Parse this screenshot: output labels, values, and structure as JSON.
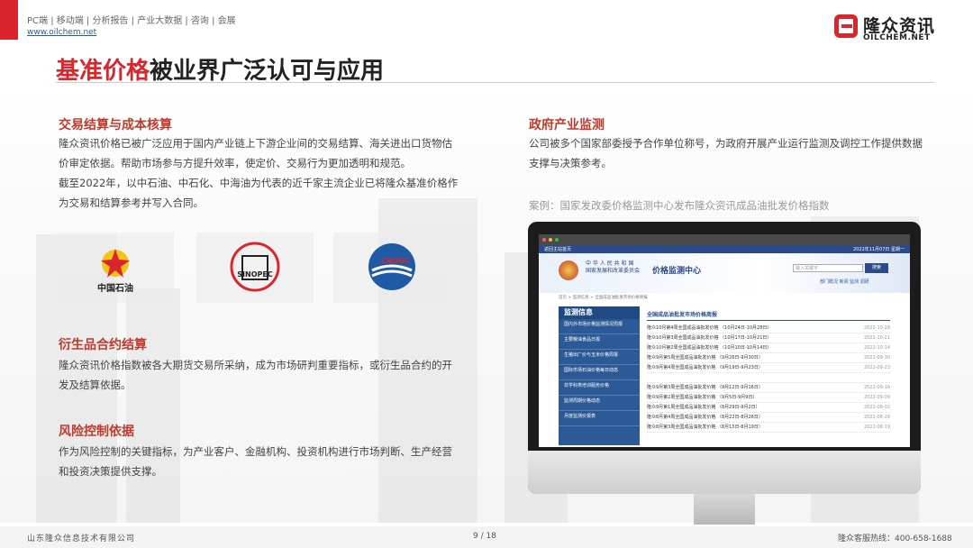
{
  "header": {
    "nav_text": "PC端 | 移动端 | 分析报告 | 产业大数据 | 咨询 | 会展",
    "site_link": "www.oilchem.net",
    "logo_cn": "隆众资讯",
    "logo_en": "OILCHEM.NET",
    "brand_color": "#d9252b"
  },
  "title": {
    "highlight": "基准价格",
    "rest": "被业界广泛认可与应用"
  },
  "left": {
    "sec1": {
      "heading": "交易结算与成本核算",
      "para1": "隆众资讯价格已被广泛应用于国内产业链上下游企业间的交易结算、海关进出口货物估价审定依据。帮助市场参与方提升效率，使定价、交易行为更加透明和规范。",
      "para2": "截至2022年，以中石油、中石化、中海油为代表的近千家主流企业已将隆众基准价格作为交易和结算参考并写入合同。"
    },
    "company_logos": [
      {
        "name": "中国石油"
      },
      {
        "name": "SINOPEC"
      },
      {
        "name": "CNOOC"
      }
    ],
    "sec2": {
      "heading": "衍生品合约结算",
      "para": "隆众资讯价格指数被各大期货交易所采纳，成为市场研判重要指标，或衍生品合约的开发及结算依据。"
    },
    "sec3": {
      "heading": "风险控制依据",
      "para": "作为风险控制的关键指标，为产业客户、金融机构、投资机构进行市场判断、生产经营和投资决策提供支撑。"
    }
  },
  "right": {
    "sec": {
      "heading": "政府产业监测",
      "para": "公司被多个国家部委授予合作单位称号，为政府开展产业运行监测及调控工作提供数据支撑与决策参考。"
    },
    "case_label": "案例：国家发改委价格监测中心发布隆众资讯成品油批发价格指数",
    "screen": {
      "subbar_left": "返回主站首页",
      "subbar_right": "2022年11月07日 星期一",
      "site_title_line1": "中 华 人 民 共 和 国",
      "site_title_line2": "国家发展和改革委员会",
      "site_title_main": "价格监测中心",
      "search_placeholder": "输入关键字",
      "search_button": "搜索",
      "links": "部门概况  新闻  监测  调研",
      "breadcrumb": "首页 > 监测信息 > 全国成品油批发市场价格周报",
      "menu_header": "监测信息",
      "menu_items": [
        "国内外市场价格监测情况周报",
        "主要粮油食品日报",
        "生猪出厂价与玉米价格周报",
        "国际市场石油价格每日动态",
        "非学科类培训服务价格",
        "监测周期价格动态",
        "月度监测价报表"
      ],
      "list_header": "全国成品油批发市场价格周报",
      "list_rows": [
        {
          "t": "隆众10月第4周全国成品油批发价格  （10月24日-10月28日）",
          "d": "2022-10-28"
        },
        {
          "t": "隆众10月第3周全国成品油批发价格  （10月17日-10月21日）",
          "d": "2022-10-21"
        },
        {
          "t": "隆众10月第2周全国成品油批发价格  （10月10日-10月14日）",
          "d": "2022-10-14"
        },
        {
          "t": "隆众9月第5周全国成品油批发价格  （9月26日-9月30日）",
          "d": "2022-09-30"
        },
        {
          "t": "隆众9月第4周全国成品油批发价格  （9月19日-9月23日）",
          "d": "2022-09-23"
        },
        {
          "t": "",
          "d": ""
        },
        {
          "t": "隆众9月第3周全国成品油批发价格  （9月12日-9月16日）",
          "d": "2022-09-16"
        },
        {
          "t": "隆众9月第2周全国成品油批发价格  （9月5日-9月9日）",
          "d": "2022-09-09"
        },
        {
          "t": "隆众9月第1周全国成品油批发价格  （8月29日-9月2日）",
          "d": "2022-09-02"
        },
        {
          "t": "隆众8月第4周全国成品油批发价格  （8月22日-8月26日）",
          "d": "2022-08-26"
        },
        {
          "t": "隆众8月第3周全国成品油批发价格  （8月15日-8月19日）",
          "d": "2022-08-19"
        }
      ]
    }
  },
  "footer": {
    "company": "山东隆众信息技术有限公司",
    "page": "9 / 18",
    "hotline": "隆众客服热线：400-658-1688"
  }
}
